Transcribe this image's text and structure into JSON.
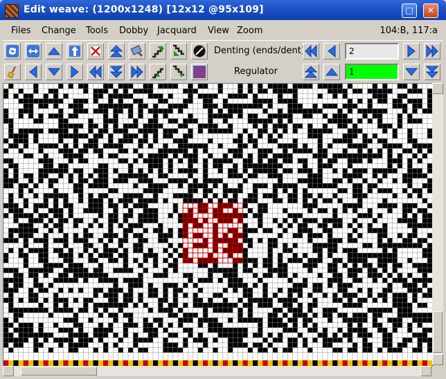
{
  "window": {
    "title": "Edit weave:  (1200x1248) [12x12 @95x109]",
    "icons": [
      "weave-app-icon",
      "maximize-icon",
      "close-icon"
    ]
  },
  "menubar": {
    "items": [
      "Files",
      "Change",
      "Tools",
      "Dobby",
      "Jacquard",
      "View",
      "Zoom"
    ],
    "status": "104:B, 117:a"
  },
  "toolbar": {
    "row1_icons": [
      "refresh-icon",
      "swap-horizontal-icon",
      "arrow-up-icon",
      "flip-vertical-icon",
      "clear-icon",
      "fast-up-icon",
      "paint-icon",
      "stairs-up-right-icon",
      "stairs-down-left-icon",
      "denting-toggle-icon"
    ],
    "row2_icons": [
      "broom-icon",
      "arrow-left-icon",
      "arrow-down-icon",
      "arrow-right-icon",
      "fast-left-icon",
      "fast-down-icon",
      "fast-right-icon",
      "stairs-up-icon",
      "stairs-down-icon",
      "pattern-grid-icon"
    ],
    "denting_label": "Denting (ends/dent)",
    "denting_value": "2",
    "regulator_label": "Regulator",
    "regulator_value": "1",
    "colors": {
      "regulator_bg": "#00ff00",
      "accent": "#1f5fd0"
    }
  },
  "grid": {
    "cells_pattern": "random-weave",
    "selection_color": "#cc0000",
    "bottom_stripe_colors": [
      "#cc0000",
      "#f0c000",
      "#000000",
      "#f0c000"
    ]
  }
}
